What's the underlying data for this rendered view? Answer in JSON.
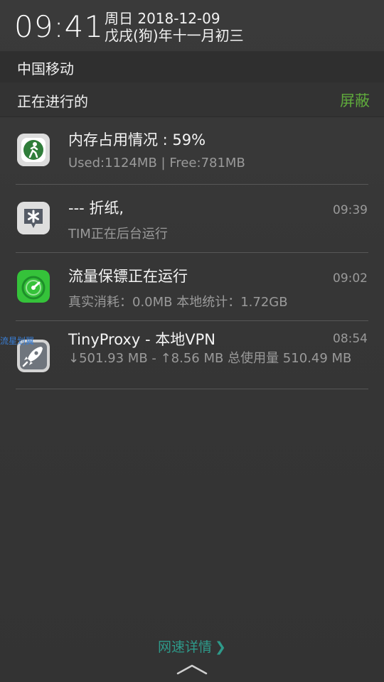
{
  "status_header": {
    "time": "09:41",
    "date": "周日 2018-12-09",
    "lunar_date": "戊戌(狗)年十一月初三"
  },
  "carrier": "中国移动",
  "ongoing": {
    "title": "正在进行的",
    "mute_label": "屏蔽"
  },
  "notifications": [
    {
      "title": "内存占用情况 : 59%",
      "subtitle": "Used:1124MB | Free:781MB",
      "time": ""
    },
    {
      "title": "--- 折纸,",
      "subtitle": "TIM正在后台运行",
      "time": "09:39"
    },
    {
      "title": "流量保镖正在运行",
      "subtitle": "真实消耗：0.0MB   本地统计：1.72GB",
      "time": "09:02"
    },
    {
      "title": "TinyProxy - 本地VPN",
      "subtitle": "↓501.93 MB - ↑8.56 MB 总使用量 510.49 MB",
      "time": "08:54"
    }
  ],
  "side_label": "流星划翼",
  "footer": {
    "net_detail_label": "网速详情",
    "net_detail_chevron": "❯"
  },
  "icons": {
    "memory": "memory-cleaner-icon",
    "tim": "tim-icon",
    "traffic": "speedometer-icon",
    "proxy": "rocket-icon",
    "collapse": "chevron-up-icon"
  },
  "colors": {
    "accent_green": "#5faa3c",
    "link_teal": "#2e9a8a",
    "traffic_icon_green": "#35c23a"
  }
}
